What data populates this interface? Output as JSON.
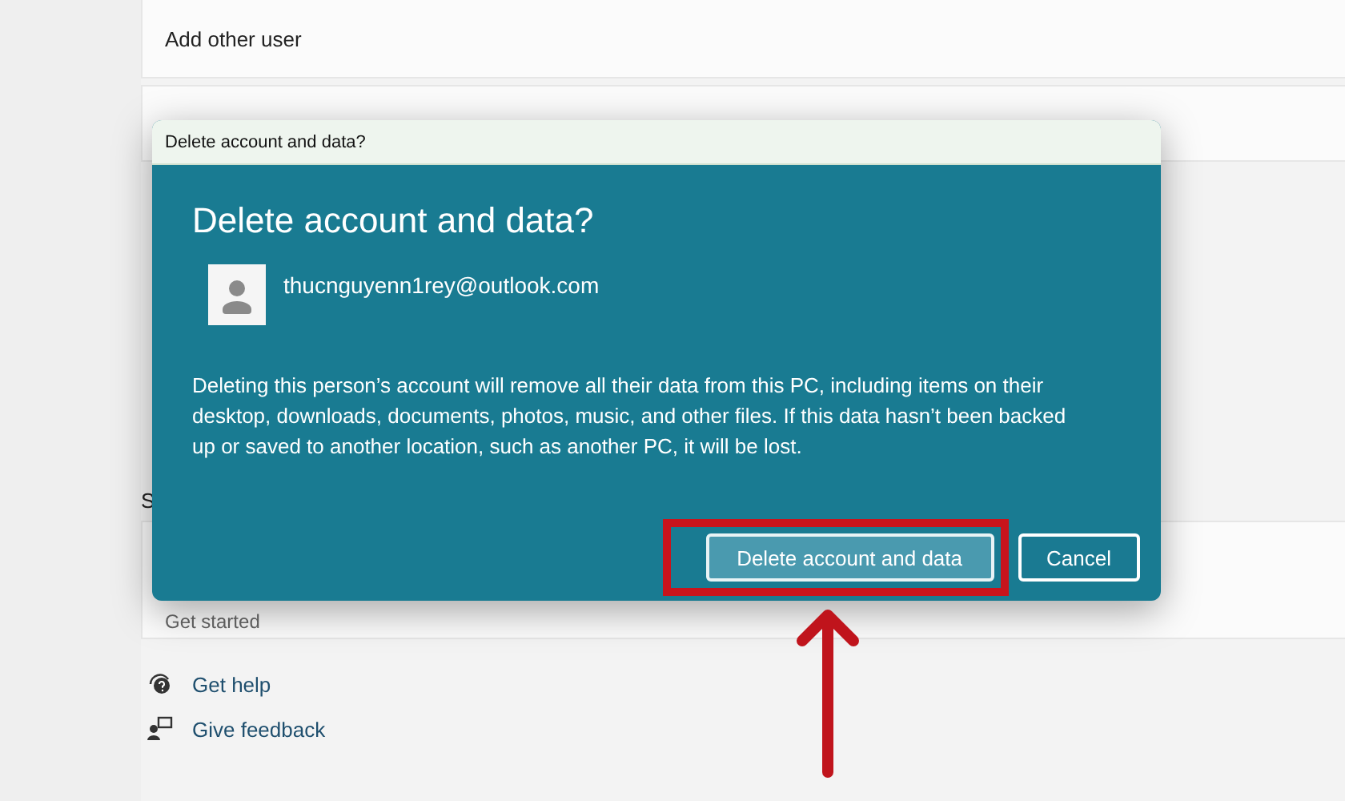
{
  "settings": {
    "add_user_label": "Add other user",
    "section_heading": "S",
    "get_started_label": "Get started",
    "links": [
      {
        "kind": "help",
        "label": "Get help"
      },
      {
        "kind": "feedback",
        "label": "Give feedback"
      }
    ]
  },
  "dialog": {
    "window_title": "Delete account and data?",
    "heading": "Delete account and data?",
    "account_email": "thucnguyenn1rey@outlook.com",
    "message": "Deleting this person’s account will remove all their data from this PC, including items on their desktop, downloads, documents, photos, music, and other files. If this data hasn’t been backed up or saved to another location, such as another PC, it will be lost.",
    "buttons": [
      {
        "label": "Delete account and data",
        "kind": "primary"
      },
      {
        "label": "Cancel",
        "kind": "secondary"
      }
    ]
  }
}
